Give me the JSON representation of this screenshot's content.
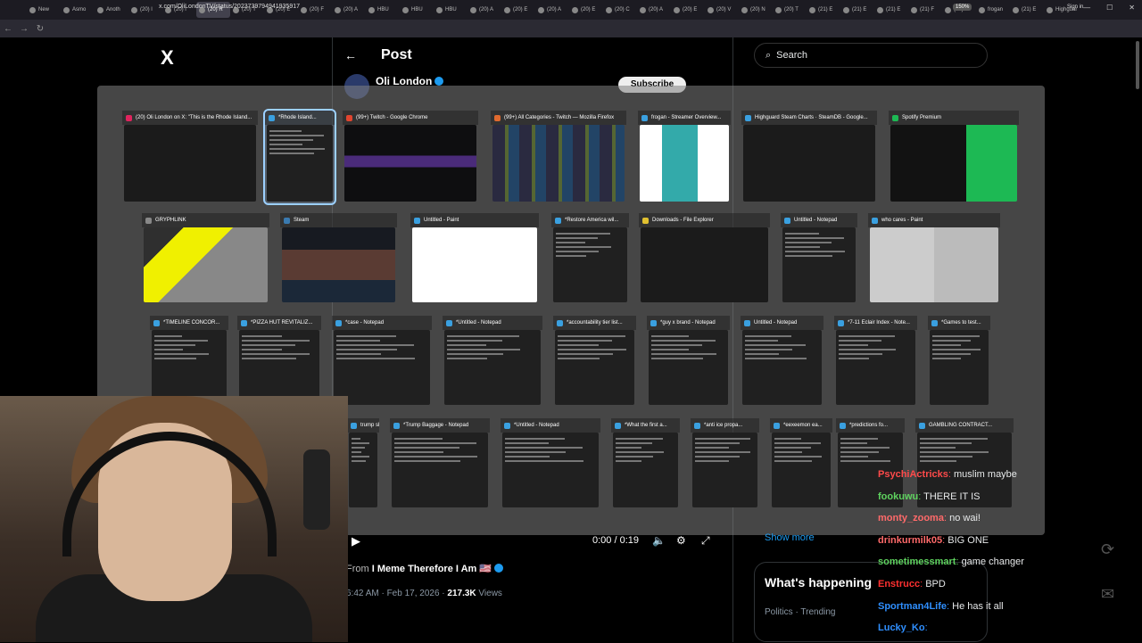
{
  "browser": {
    "tabs": [
      "New",
      "Asmo",
      "Anoth",
      "(20) l",
      "(20) l",
      "(20) R",
      "(20) T",
      "(20) E",
      "(20) F",
      "(20) A",
      "HBU",
      "HBU",
      "HBU",
      "(20) A",
      "(20) E",
      "(20) A",
      "(20) E",
      "(20) C",
      "(20) A",
      "(20) E",
      "(20) V",
      "(20) N",
      "(20) T",
      "(21) E",
      "(21) E",
      "(21) E",
      "(21) F",
      "(20) L",
      "frogan",
      "(21) E",
      "Highguar"
    ],
    "active_tab_index": 5,
    "url": "x.com/OliLondonTV/status/2023739794941935917",
    "zoom": "150%",
    "sign_in": "Sign in"
  },
  "x": {
    "logo": "X",
    "post_title": "Post",
    "author": "Oli London",
    "subscribe": "Subscribe",
    "search_placeholder": "Search",
    "video_time": "0:00 / 0:19",
    "from_label": "From",
    "from_account": "I Meme Therefore I Am 🇺🇸",
    "timestamp": "6:42 AM · Feb 17, 2026 · ",
    "views_count": "217.3K",
    "views_label": " Views",
    "show_more": "Show more",
    "whats_happening": "What's happening",
    "trend_category": "Politics · Trending"
  },
  "switcher": {
    "row1": [
      {
        "title": "(20) Oli London on X: \"This is the Rhode Island...",
        "icon_color": "#e0245e"
      },
      {
        "title": "*Rhode Island...",
        "icon_color": "#3aa0e0",
        "selected": true
      },
      {
        "title": "(99+) Twitch - Google Chrome",
        "icon_color": "#e0452f"
      },
      {
        "title": "(99+) All Categories - Twitch — Mozilla Firefox",
        "icon_color": "#e06a2f"
      },
      {
        "title": "frogan - Streamer Overview...",
        "icon_color": "#3aa0e0"
      },
      {
        "title": "Highguard Steam Charts · SteamDB - Google...",
        "icon_color": "#3aa0e0"
      },
      {
        "title": "Spotify Premium",
        "icon_color": "#1db954"
      }
    ],
    "row2": [
      {
        "title": "GRYPHLINK",
        "icon_color": "#888"
      },
      {
        "title": "Steam",
        "icon_color": "#3a7ab0"
      },
      {
        "title": "Untitled - Paint",
        "icon_color": "#3aa0e0"
      },
      {
        "title": "*Restore America wil...",
        "icon_color": "#3aa0e0"
      },
      {
        "title": "Downloads - File Explorer",
        "icon_color": "#e0c030"
      },
      {
        "title": "Untitled - Notepad",
        "icon_color": "#3aa0e0"
      },
      {
        "title": "who cares - Paint",
        "icon_color": "#3aa0e0"
      }
    ],
    "row3": [
      {
        "title": "*TIMELINE CONCOR...",
        "icon_color": "#3aa0e0"
      },
      {
        "title": "*PIZZA HUT REVITALIZ...",
        "icon_color": "#3aa0e0"
      },
      {
        "title": "*case - Notepad",
        "icon_color": "#3aa0e0"
      },
      {
        "title": "*Untitled - Notepad",
        "icon_color": "#3aa0e0"
      },
      {
        "title": "*accountability tier list...",
        "icon_color": "#3aa0e0"
      },
      {
        "title": "*guy x brand - Notepad",
        "icon_color": "#3aa0e0"
      },
      {
        "title": "Untitled - Notepad",
        "icon_color": "#3aa0e0"
      },
      {
        "title": "*7-11 Eclair Index - Note...",
        "icon_color": "#3aa0e0"
      },
      {
        "title": "*Games to test...",
        "icon_color": "#3aa0e0"
      }
    ],
    "row4": [
      {
        "title": "trump sh...",
        "icon_color": "#3aa0e0"
      },
      {
        "title": "*Trump Baggage - Notepad",
        "icon_color": "#3aa0e0"
      },
      {
        "title": "*Untitled - Notepad",
        "icon_color": "#3aa0e0"
      },
      {
        "title": "*What the first a...",
        "icon_color": "#3aa0e0"
      },
      {
        "title": "*anti ice propa...",
        "icon_color": "#3aa0e0"
      },
      {
        "title": "*eexeemon ea...",
        "icon_color": "#3aa0e0"
      },
      {
        "title": "*predictions fo...",
        "icon_color": "#3aa0e0"
      },
      {
        "title": "GAMBLING CONTRACT...",
        "icon_color": "#3aa0e0"
      }
    ]
  },
  "chat": [
    {
      "user": "PsychiActricks",
      "msg": "muslim maybe",
      "color": "#ff4a4a"
    },
    {
      "user": "fookuwu",
      "msg": "THERE IT IS",
      "color": "#5fd35f"
    },
    {
      "user": "monty_zooma",
      "msg": "no wai!",
      "color": "#ff6a6a"
    },
    {
      "user": "drinkurmilk05",
      "msg": "BIG ONE",
      "color": "#ff6a6a"
    },
    {
      "user": "sometimessmart",
      "msg": "game changer",
      "color": "#5fd35f"
    },
    {
      "user": "Enstrucc",
      "msg": "BPD",
      "color": "#ff3030"
    },
    {
      "user": "Sportman4Life",
      "msg": "He has it all",
      "color": "#2f8fff"
    },
    {
      "user": "Lucky_Ko",
      "msg": "",
      "color": "#2f8fff"
    }
  ]
}
